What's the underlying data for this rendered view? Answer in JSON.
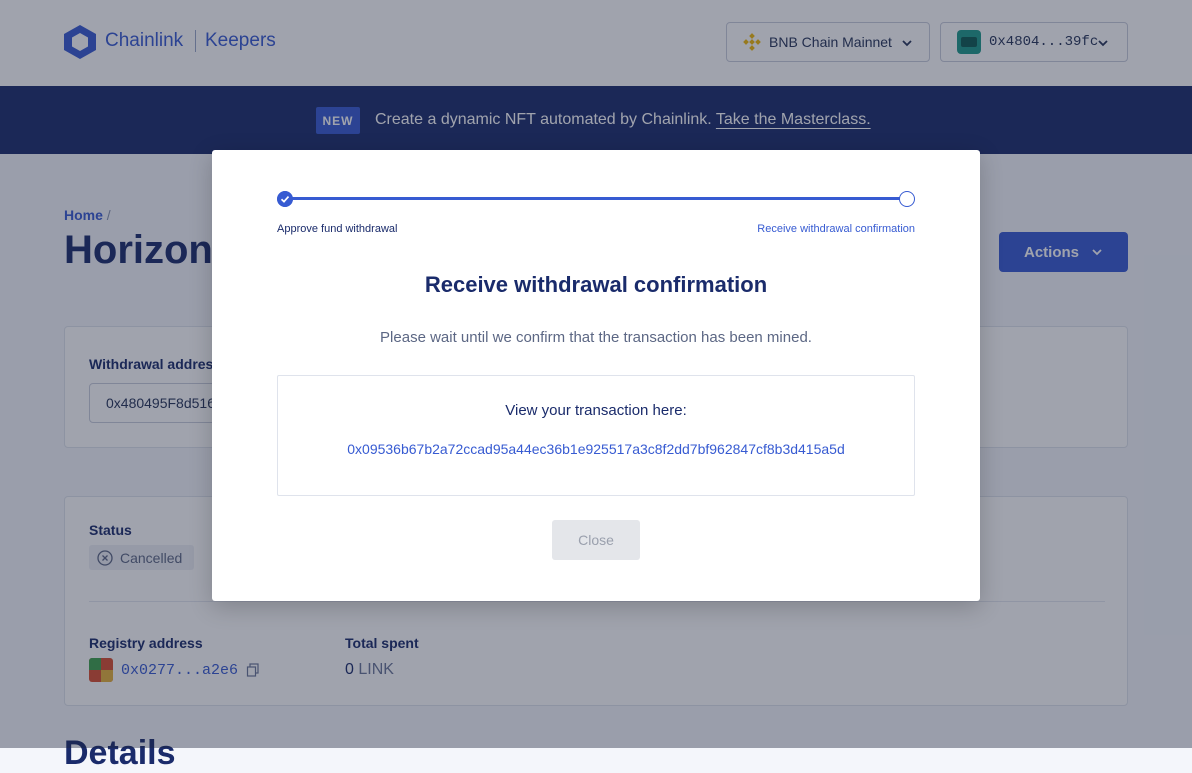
{
  "header": {
    "brand": "Chainlink",
    "product": "Keepers",
    "network_label": "BNB Chain Mainnet",
    "wallet_label": "0x4804...39fc"
  },
  "banner": {
    "badge": "NEW",
    "text": "Create a dynamic NFT automated by Chainlink.",
    "link": "Take the Masterclass."
  },
  "page": {
    "breadcrumb_home": "Home",
    "breadcrumb_sep": "/",
    "title": "Horizon",
    "actions_label": "Actions",
    "withdrawal_label": "Withdrawal address",
    "withdrawal_value": "0x480495F8d516",
    "status_label": "Status",
    "status_value": "Cancelled",
    "registry_label": "Registry address",
    "registry_value": "0x0277...a2e6",
    "total_spent_label": "Total spent",
    "total_spent_value": "0",
    "total_spent_unit": "LINK",
    "details_heading": "Details"
  },
  "modal": {
    "step1_label": "Approve fund withdrawal",
    "step2_label": "Receive withdrawal confirmation",
    "title": "Receive withdrawal confirmation",
    "message": "Please wait until we confirm that the transaction has been mined.",
    "tx_label": "View your transaction here:",
    "tx_hash": "0x09536b67b2a72ccad95a44ec36b1e925517a3c8f2dd7bf962847cf8b3d415a5d",
    "close_label": "Close"
  },
  "colors": {
    "brand_blue": "#375bd2",
    "navy": "#1a2b6b"
  },
  "icons": [
    "chainlink-logo",
    "bnb-icon",
    "chevron-down-icon",
    "wallet-avatar",
    "cancel-icon",
    "copy-icon",
    "check-icon"
  ]
}
